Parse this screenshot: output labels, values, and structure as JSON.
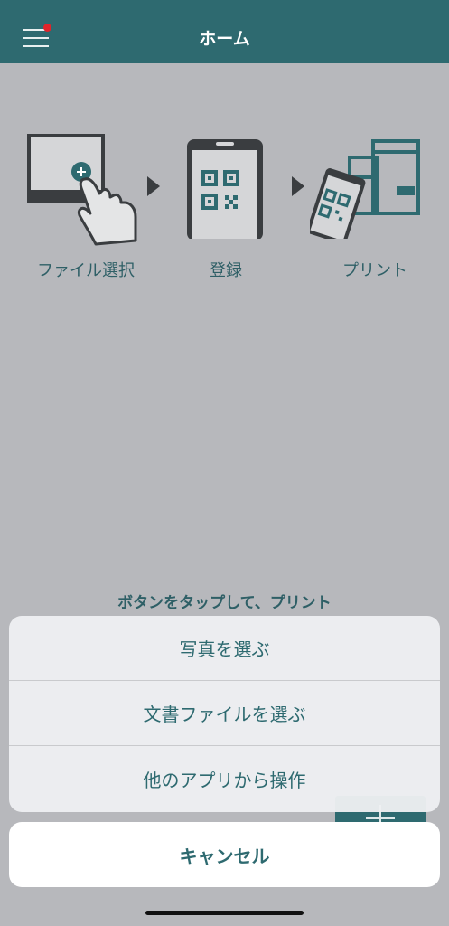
{
  "header": {
    "title": "ホーム",
    "menu_icon": "hamburger-menu-icon",
    "notification_color": "#e0242a",
    "bar_color": "#2e6a70"
  },
  "steps": [
    {
      "label": "ファイル選択",
      "icon": "tap-file-icon"
    },
    {
      "label": "登録",
      "icon": "phone-qr-icon"
    },
    {
      "label": "プリント",
      "icon": "printer-qr-icon"
    }
  ],
  "hint": {
    "line1": "ボタンをタップして、プリント"
  },
  "action_sheet": {
    "items": [
      "写真を選ぶ",
      "文書ファイルを選ぶ",
      "他のアプリから操作"
    ],
    "cancel": "キャンセル"
  }
}
